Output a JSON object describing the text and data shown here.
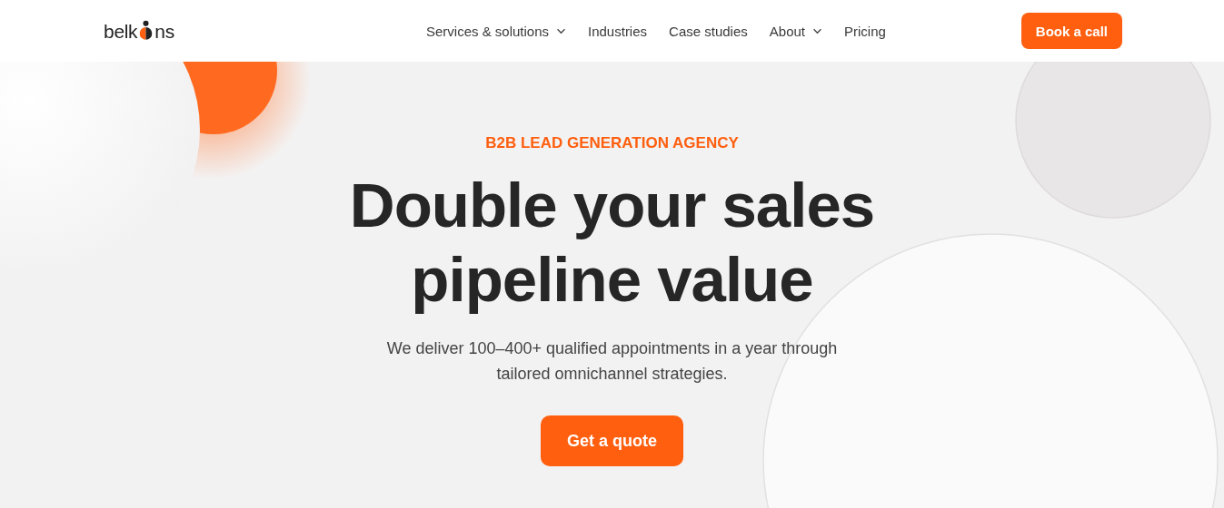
{
  "logo": {
    "before": "belk",
    "after": "ns"
  },
  "nav": [
    {
      "label": "Services & solutions",
      "has_menu": true
    },
    {
      "label": "Industries",
      "has_menu": false
    },
    {
      "label": "Case studies",
      "has_menu": false
    },
    {
      "label": "About",
      "has_menu": true
    },
    {
      "label": "Pricing",
      "has_menu": false
    }
  ],
  "header_button": "Book a call",
  "hero": {
    "eyebrow": "B2B LEAD GENERATION AGENCY",
    "title_lines": [
      "Double your sales",
      "pipeline value"
    ],
    "subtitle_lines": [
      "We deliver 100–400+ qualified appointments in a year through",
      "tailored omnichannel strategies."
    ],
    "button": "Get a quote"
  }
}
